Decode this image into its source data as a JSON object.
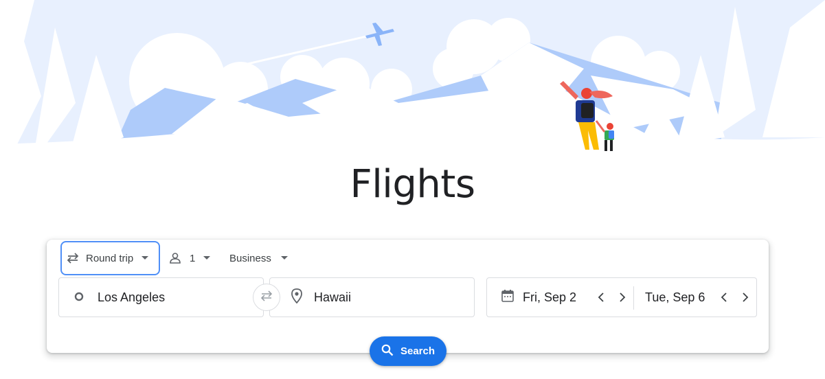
{
  "page": {
    "title": "Flights"
  },
  "options": {
    "trip_type": "Round trip",
    "passengers": "1",
    "cabin_class": "Business"
  },
  "origin": {
    "value": "Los Angeles"
  },
  "destination": {
    "value": "Hawaii"
  },
  "dates": {
    "departure": "Fri, Sep 2",
    "return": "Tue, Sep 6"
  },
  "search": {
    "label": "Search"
  },
  "colors": {
    "accent": "#1a73e8",
    "focus_outline": "#4f8ff7",
    "illustration_blue": "#aecbfa",
    "sky": "#e8f0fe"
  },
  "icons": [
    "swap-arrows-icon",
    "person-icon",
    "dropdown-caret-icon",
    "origin-circle-icon",
    "swap-icon",
    "location-pin-icon",
    "calendar-icon",
    "chevron-left-icon",
    "chevron-right-icon",
    "search-icon"
  ]
}
